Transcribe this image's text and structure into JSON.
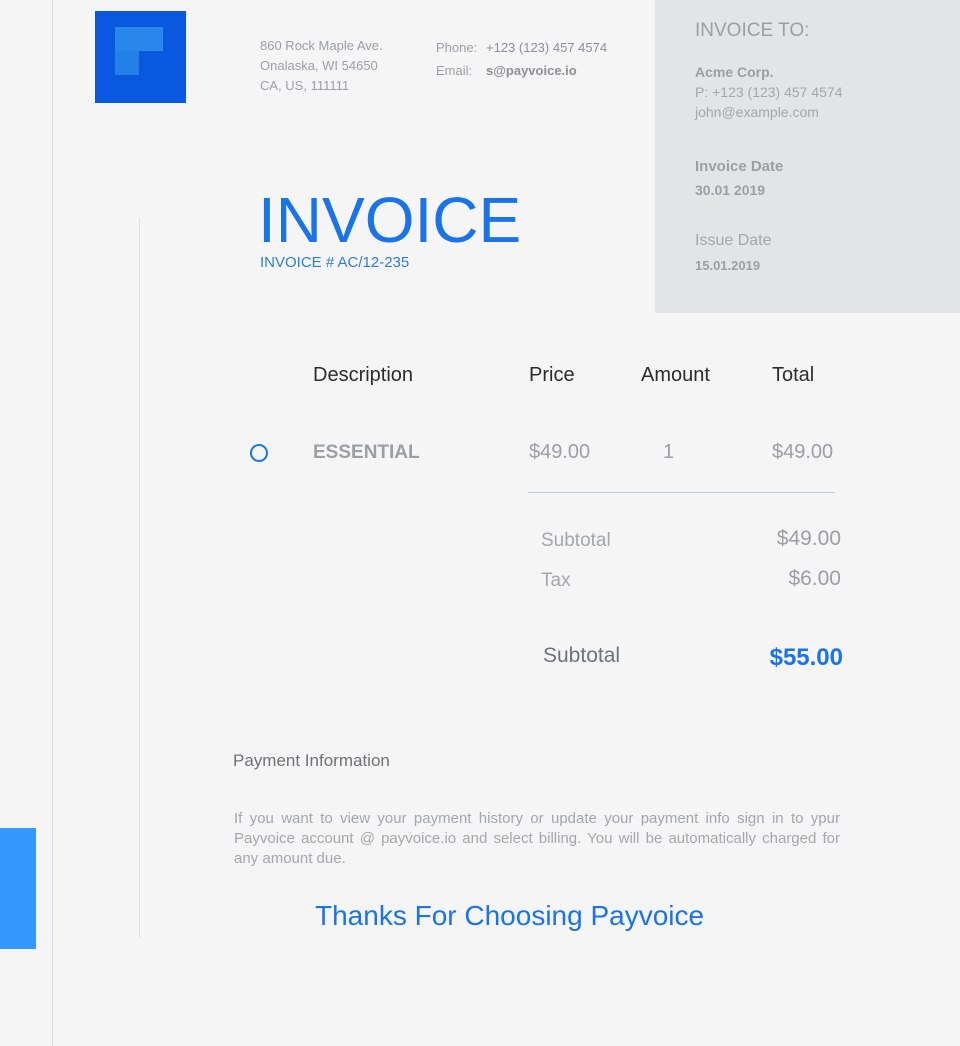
{
  "company": {
    "address_lines": [
      "860 Rock Maple Ave.",
      "Onalaska, WI 54650",
      "CA, US, 111111"
    ],
    "phone_label": "Phone:",
    "phone": "+123 (123) 457 4574",
    "email_label": "Email:",
    "email": "s@payvoice.io"
  },
  "bill_to": {
    "title": "INVOICE TO:",
    "name": "Acme Corp.",
    "phone": "P: +123 (123) 457 4574",
    "email": "john@example.com",
    "invoice_date_label": "Invoice Date",
    "invoice_date": "30.01 2019",
    "issue_date_label": "Issue Date",
    "issue_date": "15.01.2019"
  },
  "invoice": {
    "title": "INVOICE",
    "number": "INVOICE # AC/12-235"
  },
  "table": {
    "headers": [
      "Description",
      "Price",
      "Amount",
      "Total"
    ],
    "rows": [
      {
        "description": "ESSENTIAL",
        "price": "$49.00",
        "amount": "1",
        "total": "$49.00"
      }
    ]
  },
  "summary": {
    "subtotal_label": "Subtotal",
    "subtotal": "$49.00",
    "tax_label": "Tax",
    "tax": "$6.00",
    "total_label": "Subtotal",
    "total": "$55.00"
  },
  "payment": {
    "title": "Payment Information",
    "text": "If you want to view your payment history or update your payment info sign in to ypur Payvoice account @ payvoice.io and select billing. You will be automatically charged for any amount due."
  },
  "footer": {
    "thanks": "Thanks For Choosing Payvoice"
  },
  "colors": {
    "accent": "#1a73e8",
    "logo": "#0a58e0",
    "side_accent": "#3399ff",
    "panel": "#e3e4e6"
  }
}
